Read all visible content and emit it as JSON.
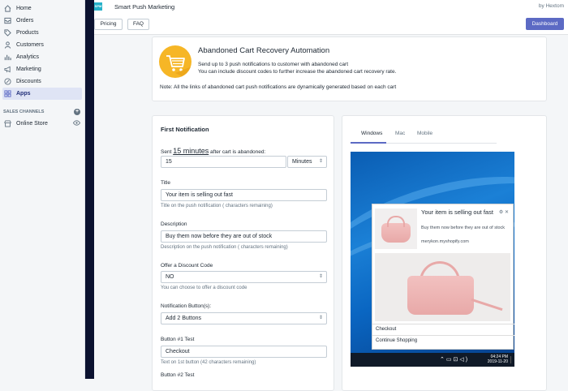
{
  "sidebar": {
    "items": [
      {
        "label": "Home",
        "icon": "home-icon"
      },
      {
        "label": "Orders",
        "icon": "orders-icon"
      },
      {
        "label": "Products",
        "icon": "tag-icon"
      },
      {
        "label": "Customers",
        "icon": "person-icon"
      },
      {
        "label": "Analytics",
        "icon": "bar-chart-icon"
      },
      {
        "label": "Marketing",
        "icon": "megaphone-icon"
      },
      {
        "label": "Discounts",
        "icon": "discount-icon"
      },
      {
        "label": "Apps",
        "icon": "apps-icon",
        "active": true
      }
    ],
    "sales_channels_title": "SALES CHANNELS",
    "online_store_label": "Online Store"
  },
  "topbar": {
    "app_logo_text": "SPM",
    "app_name": "Smart Push Marketing",
    "by_text": "by Hextom"
  },
  "buttons": {
    "pricing": "Pricing",
    "faq": "FAQ",
    "dashboard": "Dashboard"
  },
  "intro": {
    "title": "Abandoned Cart Recovery Automation",
    "line1": "Send up to 3 push notifications to customer with abandoned cart",
    "line2": "You can include discount codes to further increase the abandoned cart recovery rate.",
    "note": "Note: All the links of abandoned cart push notifications are dynamically generated based on each cart"
  },
  "form": {
    "section_title": "First Notification",
    "sent_prefix": "Sent",
    "sent_link": "15 minutes",
    "sent_suffix": "after cart is abandoned:",
    "delay_value": "15",
    "delay_unit": "Minutes",
    "title_label": "Title",
    "title_value": "Your item is selling out fast",
    "title_help": "Title on the push notification ( characters remaining)",
    "desc_label": "Description",
    "desc_value": "Buy them now before they are out of stock",
    "desc_help": "Description on the push notification ( characters remaining)",
    "discount_label": "Offer a Discount Code",
    "discount_value": "NO",
    "discount_help": "You can choose to offer a discount code",
    "buttons_label": "Notification Button(s):",
    "buttons_value": "Add 2 Buttons",
    "b1_label": "Button #1 Test",
    "b1_value": "Checkout",
    "b1_help": "Text on 1st button (42 characters remaining)",
    "b2_label": "Button #2 Test"
  },
  "preview": {
    "tabs": [
      "Windows",
      "Mac",
      "Mobile"
    ],
    "selected_tab": "Windows",
    "notif_title": "Your item is selling out fast",
    "notif_body": "Buy them now before they are out of stock",
    "notif_domain": "merykon.myshopify.com",
    "action1": "Checkout",
    "action2": "Continue Shopping",
    "clock_time": "04:24 PM",
    "clock_date": "2019-11-20"
  },
  "colors": {
    "accent": "#5c6ac4",
    "sidebar_active_bg": "#dfe4f5",
    "cart_icon": "#f6b626"
  }
}
